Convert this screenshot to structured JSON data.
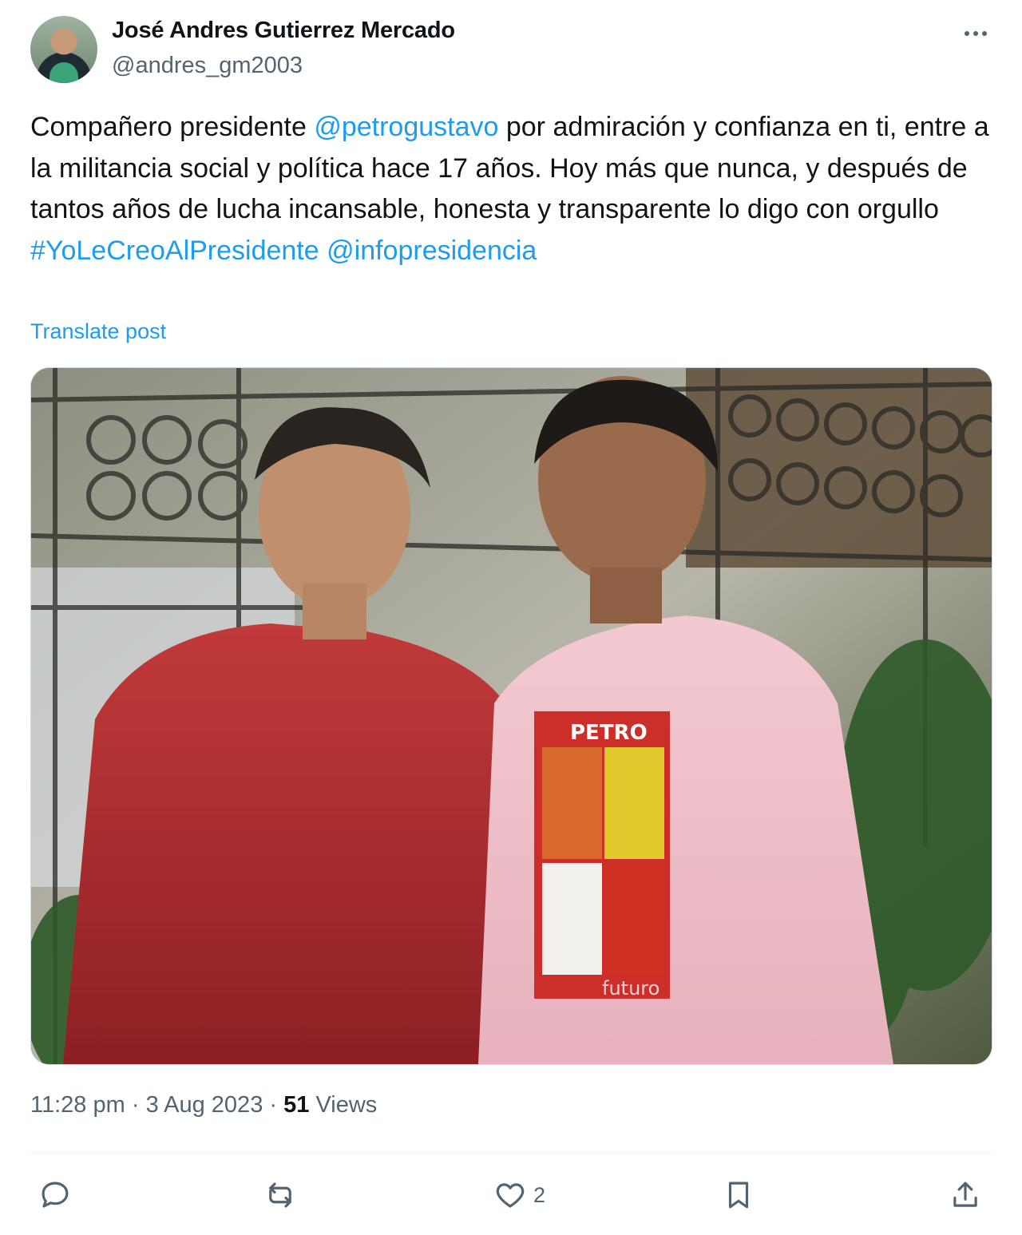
{
  "author": {
    "display_name": "José Andres Gutierrez Mercado",
    "handle": "@andres_gm2003"
  },
  "post": {
    "text_parts": [
      {
        "text": "Compañero presidente ",
        "link": false
      },
      {
        "text": "@petrogustavo",
        "link": true
      },
      {
        "text": " por admiración y confianza en ti, entre a la militancia social y política hace 17 años. Hoy más que nunca, y después de tantos años de lucha incansable, honesta y transparente lo digo con orgullo ",
        "link": false
      },
      {
        "text": "#YoLeCreoAlPresidente",
        "link": true
      },
      {
        "text": " ",
        "link": false
      },
      {
        "text": "@infopresidencia",
        "link": true
      }
    ],
    "translate_label": "Translate post",
    "image_shirt_text": [
      "PETRO",
      "futuro"
    ]
  },
  "meta": {
    "time": "11:28 pm",
    "separator": "·",
    "date": "3 Aug 2023",
    "views_count": "51",
    "views_label": "Views"
  },
  "actions": {
    "reply_icon": "reply-icon",
    "repost_icon": "repost-icon",
    "like_icon": "heart-icon",
    "like_count": "2",
    "bookmark_icon": "bookmark-icon",
    "share_icon": "share-icon"
  },
  "colors": {
    "link": "#1d9bf0",
    "secondary_text": "#536471",
    "primary_text": "#0f1419"
  }
}
